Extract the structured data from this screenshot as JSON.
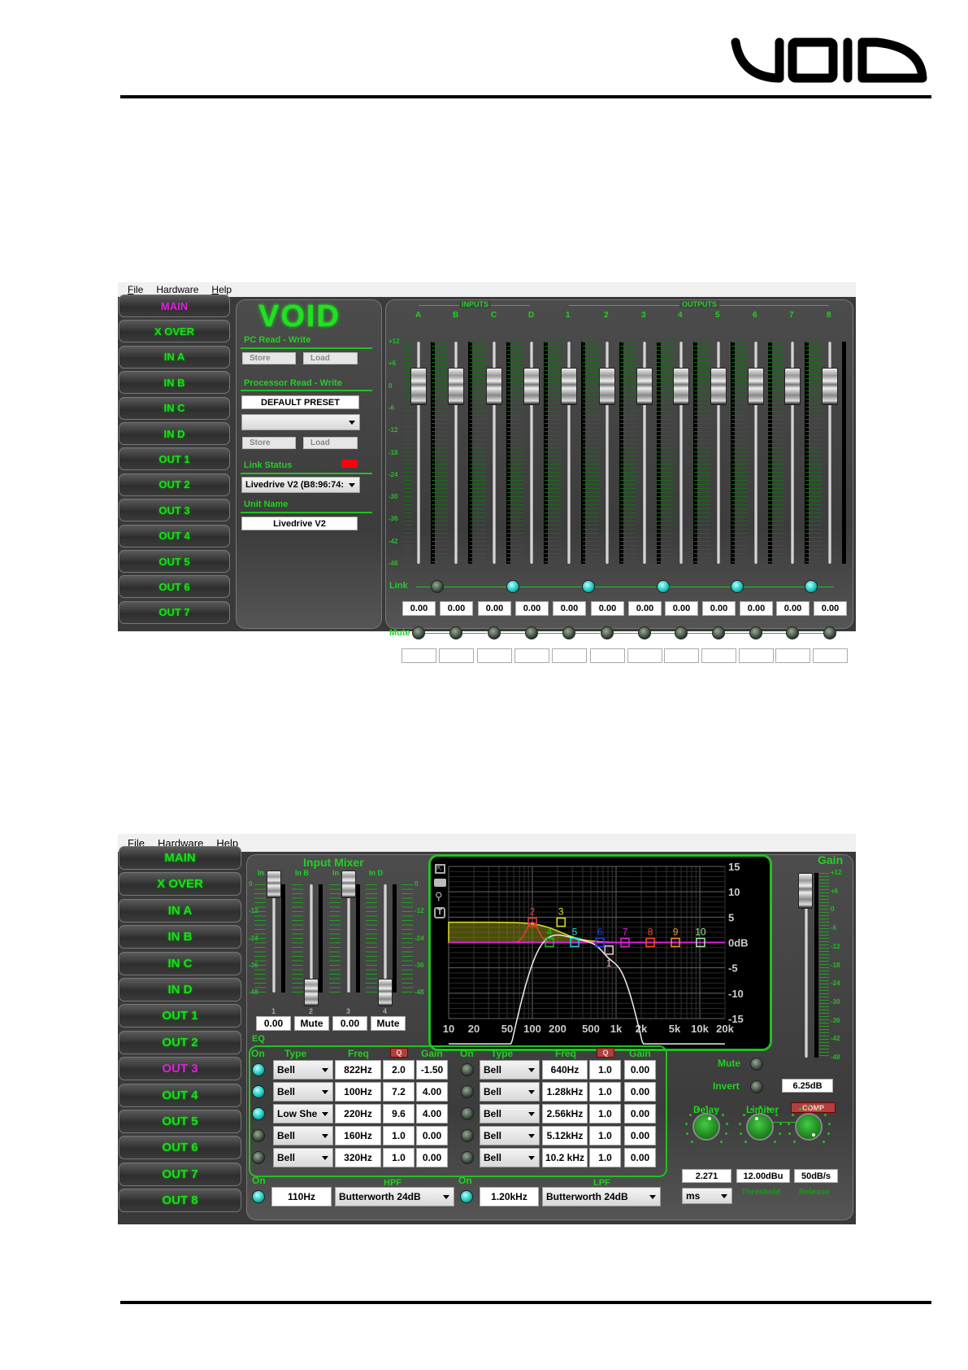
{
  "doc": {
    "logo": "VOID"
  },
  "top": {
    "menu": [
      "File",
      "Hardware",
      "Help"
    ],
    "nav": [
      {
        "label": "MAIN",
        "active": true
      },
      {
        "label": "X OVER"
      },
      {
        "label": "IN A"
      },
      {
        "label": "IN B"
      },
      {
        "label": "IN C"
      },
      {
        "label": "IN D"
      },
      {
        "label": "OUT 1"
      },
      {
        "label": "OUT 2"
      },
      {
        "label": "OUT 3"
      },
      {
        "label": "OUT 4"
      },
      {
        "label": "OUT 5"
      },
      {
        "label": "OUT 6"
      },
      {
        "label": "OUT 7"
      },
      {
        "label": "OUT 8"
      }
    ],
    "logo": "VOID",
    "pc_title": "PC Read - Write",
    "store": "Store",
    "load": "Load",
    "proc_title": "Processor Read - Write",
    "preset": "DEFAULT PRESET",
    "preset_select": "",
    "link_status_title": "Link Status",
    "link_status_color": "#ff0010",
    "device_select": "Livedrive V2 (B8:96:74:",
    "unit_name_title": "Unit Name",
    "unit_name": "Livedrive V2",
    "inputs_label": "INPUTS",
    "outputs_label": "OUTPUTS",
    "scale": [
      "+12",
      "+6",
      "0",
      "-6",
      "-12",
      "-18",
      "-24",
      "-30",
      "-36",
      "-42",
      "-48"
    ],
    "link_label": "Link",
    "mute_label": "Mute",
    "channels": [
      {
        "name": "A",
        "value": "0.00",
        "level_db": 0
      },
      {
        "name": "B",
        "value": "0.00",
        "level_db": 0
      },
      {
        "name": "C",
        "value": "0.00",
        "level_db": 0
      },
      {
        "name": "D",
        "value": "0.00",
        "level_db": 0
      },
      {
        "name": "1",
        "value": "0.00",
        "level_db": 0
      },
      {
        "name": "2",
        "value": "0.00",
        "level_db": 0
      },
      {
        "name": "3",
        "value": "0.00",
        "level_db": 0
      },
      {
        "name": "4",
        "value": "0.00",
        "level_db": 0
      },
      {
        "name": "5",
        "value": "0.00",
        "level_db": 0
      },
      {
        "name": "6",
        "value": "0.00",
        "level_db": 0
      },
      {
        "name": "7",
        "value": "0.00",
        "level_db": 0
      },
      {
        "name": "8",
        "value": "0.00",
        "level_db": 0
      }
    ],
    "links_on": [
      false,
      true,
      true,
      true,
      true,
      true
    ]
  },
  "bottom": {
    "menu": [
      "File",
      "Hardware",
      "Help"
    ],
    "nav": [
      {
        "label": "MAIN"
      },
      {
        "label": "X OVER"
      },
      {
        "label": "IN A"
      },
      {
        "label": "IN B"
      },
      {
        "label": "IN C"
      },
      {
        "label": "IN D"
      },
      {
        "label": "OUT 1"
      },
      {
        "label": "OUT 2"
      },
      {
        "label": "OUT 3",
        "active": true
      },
      {
        "label": "OUT 4"
      },
      {
        "label": "OUT 5"
      },
      {
        "label": "OUT 6"
      },
      {
        "label": "OUT 7"
      },
      {
        "label": "OUT 8"
      }
    ],
    "input_mixer": {
      "title": "Input Mixer",
      "scale": [
        "0",
        "-12",
        "-24",
        "-36",
        "-48"
      ],
      "channels": [
        {
          "label": "In A",
          "num": "1",
          "value": "0.00",
          "level_db": 0
        },
        {
          "label": "In B",
          "num": "2",
          "value": "Mute",
          "level_db": -48
        },
        {
          "label": "In C",
          "num": "3",
          "value": "0.00",
          "level_db": 0
        },
        {
          "label": "In D",
          "num": "4",
          "value": "Mute",
          "level_db": -48
        }
      ]
    },
    "eq_label": "EQ",
    "headers": {
      "on": "On",
      "type": "Type",
      "freq": "Freq",
      "q": "Q",
      "gain": "Gain"
    },
    "bands": [
      {
        "on": true,
        "type": "Bell",
        "freq": "822Hz",
        "q": "2.0",
        "gain": "-1.50"
      },
      {
        "on": true,
        "type": "Bell",
        "freq": "100Hz",
        "q": "7.2",
        "gain": "4.00"
      },
      {
        "on": true,
        "type": "Low She",
        "freq": "220Hz",
        "q": "9.6",
        "gain": "4.00"
      },
      {
        "on": false,
        "type": "Bell",
        "freq": "160Hz",
        "q": "1.0",
        "gain": "0.00"
      },
      {
        "on": false,
        "type": "Bell",
        "freq": "320Hz",
        "q": "1.0",
        "gain": "0.00"
      },
      {
        "on": false,
        "type": "Bell",
        "freq": "640Hz",
        "q": "1.0",
        "gain": "0.00"
      },
      {
        "on": false,
        "type": "Bell",
        "freq": "1.28kHz",
        "q": "1.0",
        "gain": "0.00"
      },
      {
        "on": false,
        "type": "Bell",
        "freq": "2.56kHz",
        "q": "1.0",
        "gain": "0.00"
      },
      {
        "on": false,
        "type": "Bell",
        "freq": "5.12kHz",
        "q": "1.0",
        "gain": "0.00"
      },
      {
        "on": false,
        "type": "Bell",
        "freq": "10.2 kHz",
        "q": "1.0",
        "gain": "0.00"
      }
    ],
    "hpf": {
      "label": "HPF",
      "on_label": "On",
      "on": true,
      "freq": "110Hz",
      "type": "Butterworth 24dB"
    },
    "lpf": {
      "label": "LPF",
      "on_label": "On",
      "on": true,
      "freq": "1.20kHz",
      "type": "Butterworth 24dB"
    },
    "gain": {
      "label": "Gain",
      "value": "6.25dB",
      "level_db": 6.25,
      "scale": [
        "+12",
        "+6",
        "0",
        "-6",
        "-12",
        "-18",
        "-24",
        "-30",
        "-36",
        "-42",
        "-48"
      ]
    },
    "mute_label": "Mute",
    "invert_label": "Invert",
    "delay": {
      "label": "Delay",
      "value": "2.271",
      "unit": "ms"
    },
    "limiter": {
      "label": "Limiter",
      "comp": "COMP",
      "threshold": "12.00dBu",
      "threshold_label": "Threshold",
      "release": "50dB/s",
      "release_label": "Release"
    }
  },
  "chart_data": {
    "type": "line",
    "title": "EQ response",
    "xscale": "log",
    "xlim": [
      10,
      20000
    ],
    "ylim": [
      -15,
      15
    ],
    "xticks": [
      "10",
      "20",
      "50",
      "100",
      "200",
      "500",
      "1k",
      "2k",
      "5k",
      "10k",
      "20k"
    ],
    "xtick_values": [
      10,
      20,
      50,
      100,
      200,
      500,
      1000,
      2000,
      5000,
      10000,
      20000
    ],
    "yticks": [
      "15",
      "10",
      "5",
      "0dB",
      "-5",
      "-10",
      "-15"
    ],
    "ytick_values": [
      15,
      10,
      5,
      0,
      -5,
      -10,
      -15
    ],
    "markers": [
      {
        "id": "1",
        "freq": 822,
        "gain": -1.5,
        "color": "#f0c0d0"
      },
      {
        "id": "2",
        "freq": 100,
        "gain": 4,
        "color": "#e04040"
      },
      {
        "id": "3",
        "freq": 220,
        "gain": 4,
        "color": "#e0e020"
      },
      {
        "id": "4",
        "freq": 160,
        "gain": 0,
        "color": "#20c020"
      },
      {
        "id": "5",
        "freq": 320,
        "gain": 0,
        "color": "#20d0e0"
      },
      {
        "id": "6",
        "freq": 640,
        "gain": 0,
        "color": "#2040e0"
      },
      {
        "id": "7",
        "freq": 1280,
        "gain": 0,
        "color": "#e020e0"
      },
      {
        "id": "8",
        "freq": 2560,
        "gain": 0,
        "color": "#ff5020"
      },
      {
        "id": "9",
        "freq": 5120,
        "gain": 0,
        "color": "#f09030"
      },
      {
        "id": "10",
        "freq": 10200,
        "gain": 0,
        "color": "#a0f0a0"
      }
    ],
    "hpf_hz": 110,
    "lpf_hz": 1200,
    "tools": [
      "zoom-extents",
      "camera",
      "zoom",
      "text"
    ]
  }
}
